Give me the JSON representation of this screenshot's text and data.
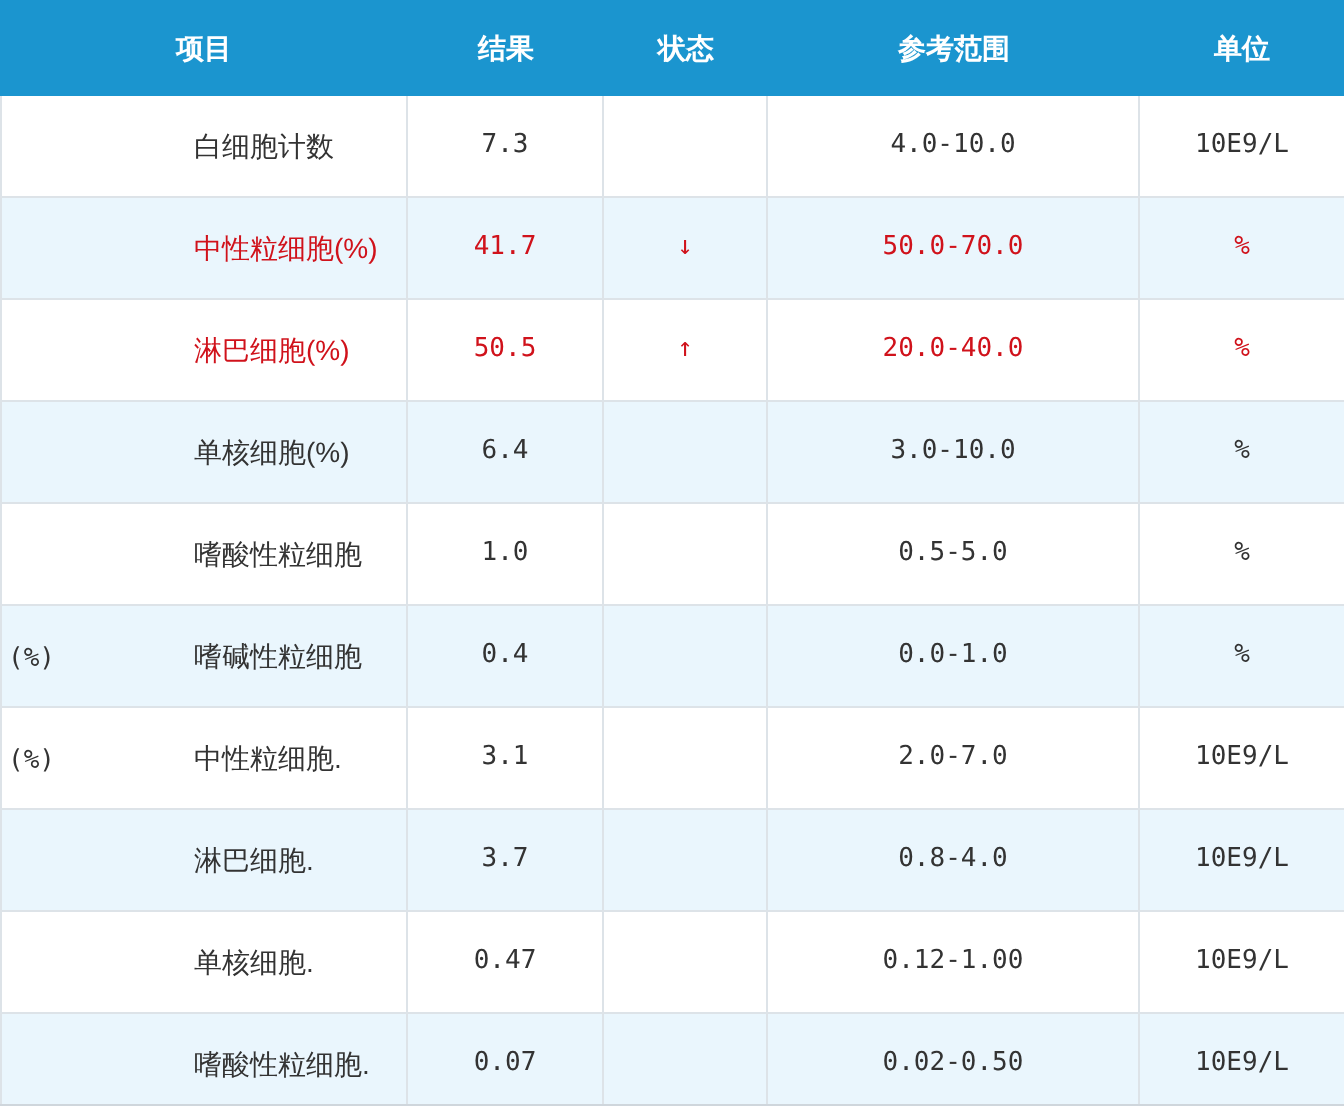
{
  "table": {
    "columns": [
      "项目",
      "结果",
      "状态",
      "参考范围",
      "单位"
    ],
    "rows": [
      {
        "item": "白细胞计数",
        "result": "7.3",
        "range": "4.0-10.0",
        "unit": "10E9/L",
        "abnormal": false
      },
      {
        "item": "中性粒细胞(%)",
        "result": "41.7",
        "status": "↓",
        "range": "50.0-70.0",
        "unit": "%",
        "abnormal": true
      },
      {
        "item": "淋巴细胞(%)",
        "result": "50.5",
        "status": "↑",
        "range": "20.0-40.0",
        "unit": "%",
        "abnormal": true
      },
      {
        "item": "单核细胞(%)",
        "result": "6.4",
        "range": "3.0-10.0",
        "unit": "%",
        "abnormal": false
      },
      {
        "item": "嗜酸性粒细胞",
        "result": "1.0",
        "range": "0.5-5.0",
        "unit": "%",
        "abnormal": false
      },
      {
        "prefix": "(%)",
        "item": "嗜碱性粒细胞",
        "result": "0.4",
        "range": "0.0-1.0",
        "unit": "%",
        "abnormal": false
      },
      {
        "prefix": "(%)",
        "item": "中性粒细胞.",
        "result": "3.1",
        "range": "2.0-7.0",
        "unit": "10E9/L",
        "abnormal": false
      },
      {
        "item": "淋巴细胞.",
        "result": "3.7",
        "range": "0.8-4.0",
        "unit": "10E9/L",
        "abnormal": false
      },
      {
        "item": "单核细胞.",
        "result": "0.47",
        "range": "0.12-1.00",
        "unit": "10E9/L",
        "abnormal": false
      },
      {
        "item": "嗜酸性粒细胞.",
        "result": "0.07",
        "range": "0.02-0.50",
        "unit": "10E9/L",
        "abnormal": false
      }
    ]
  }
}
